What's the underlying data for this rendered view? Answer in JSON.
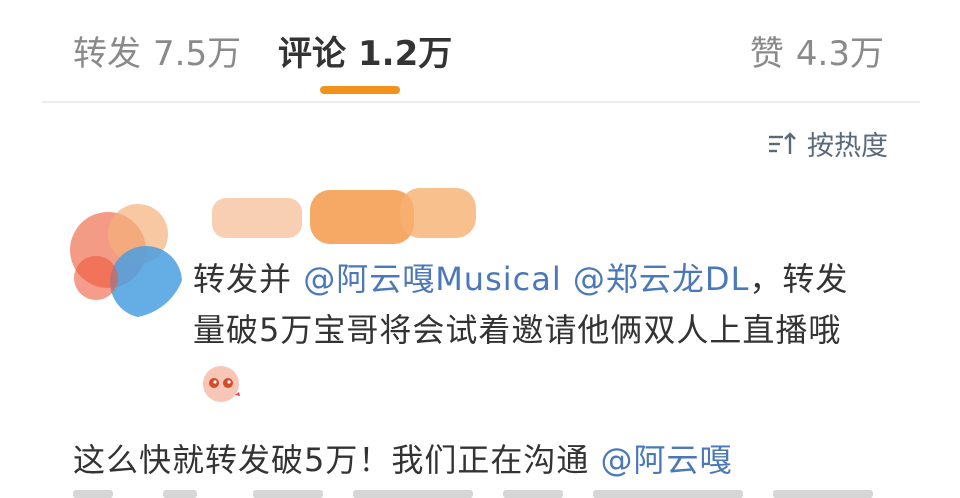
{
  "tabs": [
    {
      "label": "转发",
      "count": "7.5万"
    },
    {
      "label": "评论",
      "count": "1.2万"
    },
    {
      "label": "赞",
      "count": "4.3万"
    }
  ],
  "sort": {
    "label": "按热度",
    "icon": "sort-icon"
  },
  "comment": {
    "avatar_icon": "user-avatar",
    "text_prefix": "转发并 ",
    "mention1": "@阿云嘎Musical",
    "mention2": "@郑云龙DL",
    "text_suffix": "，转发量破5万宝哥将会试着邀请他俩双人上直播哦",
    "emoji_icon": "cute-emoji-icon"
  },
  "reply": {
    "text": "这么快就转发破5万！我们正在沟通 ",
    "mention": "@阿云嘎"
  },
  "colors": {
    "accent": "#f0921c",
    "link": "#4a78b8",
    "muted": "#8a8a8a"
  }
}
